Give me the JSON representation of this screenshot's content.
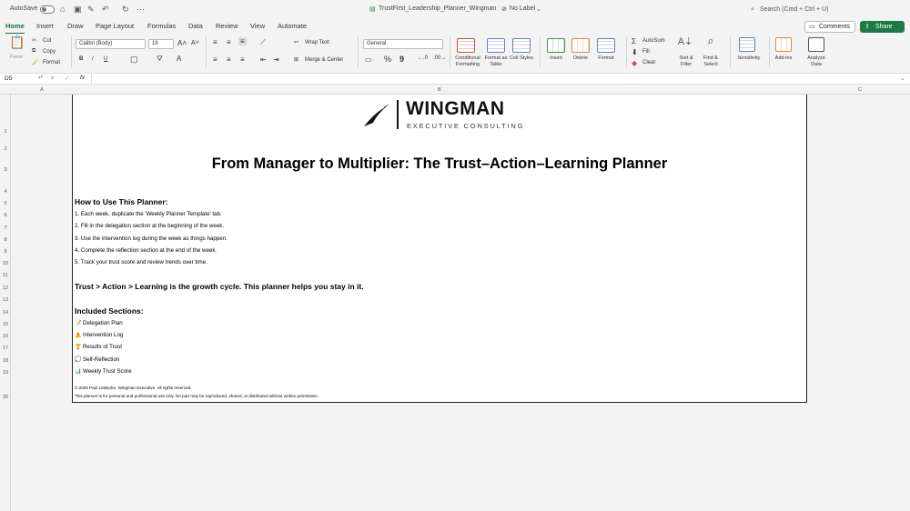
{
  "titlebar": {
    "autosave_label": "AutoSave",
    "file_name": "TrustFirst_Leadership_Planner_Wingman",
    "sensitivity_label": "No Label",
    "search_placeholder": "Search (Cmd + Ctrl + U)"
  },
  "tabs": [
    "Home",
    "Insert",
    "Draw",
    "Page Layout",
    "Formulas",
    "Data",
    "Review",
    "View",
    "Automate"
  ],
  "actions": {
    "comments": "Comments",
    "share": "Share"
  },
  "ribbon": {
    "paste": "Paste",
    "cut": "Cut",
    "copy": "Copy",
    "format_painter": "Format",
    "font_name": "Calibri (Body)",
    "font_size": "18",
    "bold": "B",
    "italic": "I",
    "underline": "U",
    "wrap_text": "Wrap Text",
    "merge_center": "Merge & Center",
    "number_format": "General",
    "percent": "%",
    "comma": "9",
    "conditional_formatting": "Conditional Formatting",
    "format_as_table": "Format as Table",
    "cell_styles": "Cell Styles",
    "insert": "Insert",
    "delete": "Delete",
    "format": "Format",
    "autosum": "AutoSum",
    "fill": "Fill",
    "clear": "Clear",
    "sort_filter": "Sort & Filter",
    "find_select": "Find & Select",
    "sensitivity": "Sensitivity",
    "add_ins": "Add-ins",
    "analyze_data": "Analyze Data"
  },
  "formula_bar": {
    "name_box": "D5",
    "fx": "fx",
    "value": ""
  },
  "columns": [
    "A",
    "B",
    "C"
  ],
  "rows": [
    "1",
    "2",
    "3",
    "4",
    "5",
    "6",
    "7",
    "8",
    "9",
    "10",
    "11",
    "12",
    "13",
    "14",
    "15",
    "16",
    "17",
    "18",
    "19",
    "20"
  ],
  "document": {
    "logo_name": "WINGMAN",
    "logo_sub": "EXECUTIVE CONSULTING",
    "title": "From Manager to Multiplier: The Trust–Action–Learning Planner",
    "howto_heading": "How to Use This Planner:",
    "steps": [
      "1. Each week, duplicate the 'Weekly Planner Template' tab.",
      "2. Fill in the delegation section at the beginning of the week.",
      "3. Use the intervention log during the week as things happen.",
      "4. Complete the reflection section at the end of the week.",
      "5. Track your trust score and review trends over time."
    ],
    "cycle_statement": "Trust > Action > Learning is the growth cycle. This planner helps you stay in it.",
    "sections_heading": "Included Sections:",
    "sections": [
      {
        "icon": "📝",
        "label": "Delegation Plan"
      },
      {
        "icon": "⚠️",
        "label": "Intervention Log"
      },
      {
        "icon": "🏆",
        "label": "Results of Trust"
      },
      {
        "icon": "💭",
        "label": "Self-Reflection"
      },
      {
        "icon": "📊",
        "label": "Weekly Trust Score"
      }
    ],
    "copyright": "© 2025 Paul Littlejohn, Wingman Executive. All rights reserved.",
    "license": "This planner is for personal and professional use only. No part may be reproduced, shared, or distributed without written permission."
  },
  "colors": {
    "accent": "#1e6b3a",
    "share": "#1e7a43"
  }
}
